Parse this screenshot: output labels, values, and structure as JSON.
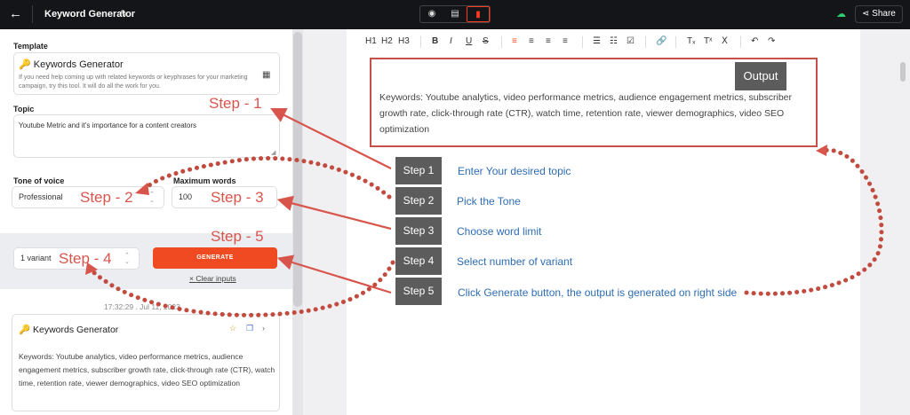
{
  "header": {
    "title": "Keyword Generator",
    "back_icon": "arrow-left-icon",
    "view_icons": [
      "eye-icon",
      "chat-icon",
      "panel-icon"
    ],
    "share_label": "Share"
  },
  "form": {
    "template_label": "Template",
    "template_name": "Keywords Generator",
    "template_desc": "If you need help coming up with related keywords or keyphrases for your marketing campaign, try this tool. It will do all the work for you.",
    "topic_label": "Topic",
    "topic_value": "Youtube Metric and it's importance for a content creators",
    "tone_label": "Tone of voice",
    "tone_value": "Professional",
    "maxwords_label": "Maximum words",
    "maxwords_value": "100",
    "variant_value": "1 variant",
    "generate_label": "GENERATE",
    "clear_label": "Clear inputs"
  },
  "history": {
    "timestamp": "17:32:29 . Jul 11, 2023",
    "title": "Keywords Generator",
    "text": "Keywords: Youtube analytics, video performance metrics, audience engagement metrics, subscriber growth rate, click-through rate (CTR), watch time, retention rate, viewer demographics, video SEO optimization"
  },
  "toolbar": {
    "h1": "H1",
    "h2": "H2",
    "h3": "H3"
  },
  "annotations": {
    "output_label": "Output",
    "output_text": "Keywords: Youtube analytics, video performance metrics, audience engagement metrics, subscriber growth rate, click-through rate (CTR), watch time, retention rate, viewer demographics, video SEO optimization",
    "step_labels": [
      "Step - 1",
      "Step - 2",
      "Step - 3",
      "Step - 4",
      "Step - 5"
    ],
    "steps": [
      {
        "label": "Step 1",
        "text": "Enter   Your desired topic"
      },
      {
        "label": "Step 2",
        "text": "Pick the  Tone"
      },
      {
        "label": "Step 3",
        "text": "Choose word limit"
      },
      {
        "label": "Step 4",
        "text": "Select number of variant"
      },
      {
        "label": "Step 5",
        "text": "Click Generate button, the output is generated on right side"
      }
    ]
  },
  "colors": {
    "accent": "#f04a22",
    "annotation": "#d8554c",
    "topbar": "#141518",
    "step_text": "#2e6db3"
  }
}
